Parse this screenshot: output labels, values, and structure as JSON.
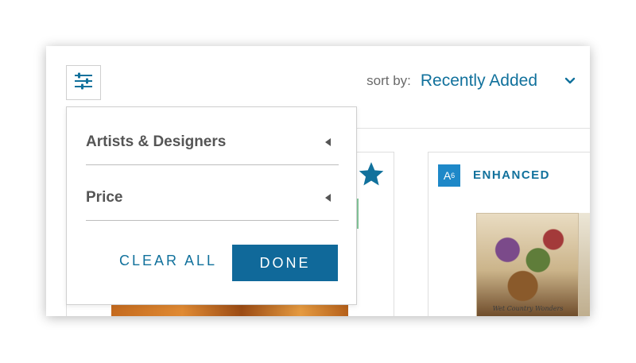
{
  "toolbar": {
    "filter_icon": "sliders-icon",
    "sort_label": "sort by:",
    "sort_value": "Recently Added",
    "sort_chevron_icon": "chevron-down-icon"
  },
  "filter_panel": {
    "sections": [
      {
        "label": "Artists & Designers",
        "icon": "caret-left-icon"
      },
      {
        "label": "Price",
        "icon": "caret-left-icon"
      }
    ],
    "clear_all_label": "CLEAR ALL",
    "done_label": "DONE"
  },
  "products": [
    {
      "favorite_icon": "star-icon"
    },
    {
      "badge_letter": "A",
      "badge_number": "6",
      "badge_label": "ENHANCED",
      "thumbnail_caption": "Wet Country Wonders"
    }
  ],
  "colors": {
    "accent": "#11719c",
    "done_button": "#10699a",
    "badge": "#1e88c8",
    "text_muted": "#555555"
  }
}
